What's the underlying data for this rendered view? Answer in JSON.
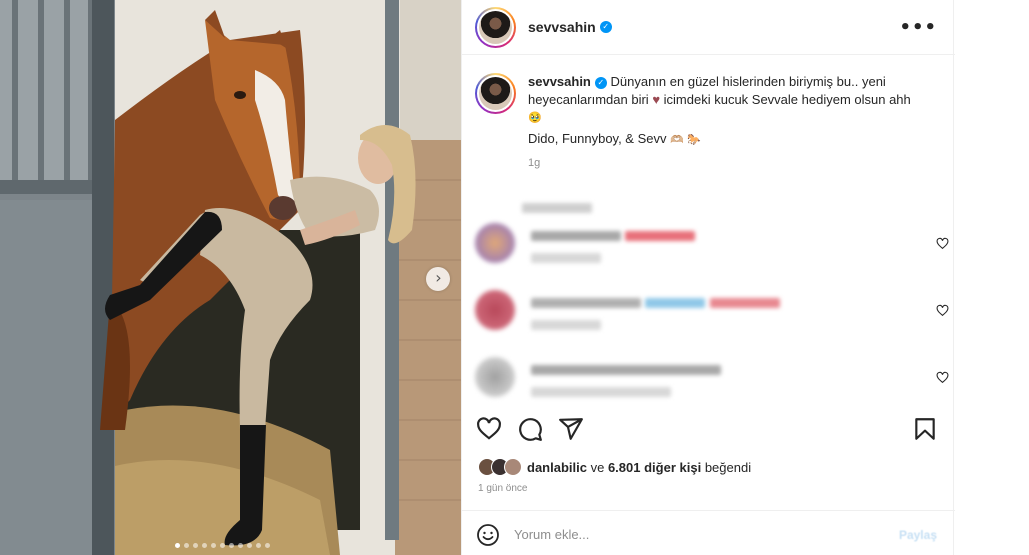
{
  "post": {
    "username": "sevvsahin",
    "verified": true,
    "more_icon": "ellipsis-icon",
    "image_alt": "photo"
  },
  "caption": {
    "username": "sevvsahin",
    "text": "Dünyanın en güzel hislerinden biriymiş bu.. yeni heyecanlarımdan biri",
    "text_after_heart": " icimdeki kucuk Sevvale hediyem olsun ahh",
    "emoji_end": "🥹",
    "line2": "Dido, Funnyboy, & Sevv",
    "line2_emojis": "🫶🏼 🐎",
    "time": "1g"
  },
  "media": {
    "carousel_total": 11,
    "carousel_active": 0,
    "next_icon": "chevron-right-icon"
  },
  "actions": {
    "like_icon": "heart-outline-icon",
    "comment_icon": "comment-icon",
    "share_icon": "send-icon",
    "save_icon": "bookmark-icon"
  },
  "likes": {
    "first_liker": "danlabilic",
    "connector": "ve",
    "others": "6.801 diğer kişi",
    "suffix": "beğendi"
  },
  "posted": "1 gün önce",
  "composer": {
    "placeholder": "Yorum ekle...",
    "share_label": "Paylaş",
    "emoji_icon": "smiley-icon"
  },
  "colors": {
    "verified": "#0095f6",
    "secondary_text": "#8e8e8e",
    "border": "#efefef"
  }
}
